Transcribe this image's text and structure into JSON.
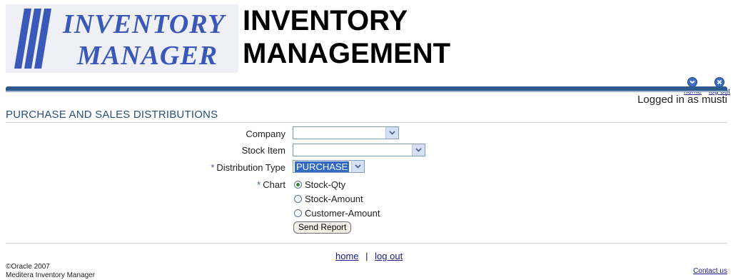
{
  "branding": {
    "logo_line1": "INVENTORY",
    "logo_line2": "MANAGER",
    "heading_line1": "INVENTORY",
    "heading_line2": "MANAGEMENT"
  },
  "global_nav": {
    "home_label": "home",
    "logout_label": "log out"
  },
  "session": {
    "logged_in_text": "Logged in as musti"
  },
  "page": {
    "title": "PURCHASE AND SALES DISTRIBUTIONS"
  },
  "form": {
    "company_label": "Company",
    "company_value": "",
    "stock_item_label": "Stock Item",
    "stock_item_value": "",
    "distribution_type_label": "Distribution Type",
    "distribution_type_value": "PURCHASE",
    "chart_label": "Chart",
    "required_marker": "*",
    "chart_options": [
      "Stock-Qty",
      "Stock-Amount",
      "Customer-Amount"
    ],
    "chart_selected": "Stock-Qty",
    "send_label": "Send Report"
  },
  "footer": {
    "home_label": "home",
    "separator": "|",
    "logout_label": "log out",
    "copyright": "©Oracle 2007",
    "app_name": "Meditera Inventory Manager",
    "contact_label": "Contact us"
  },
  "colors": {
    "accent": "#2c5a8c",
    "section_title": "#2a4f7c",
    "logo_blue": "#3a58b8",
    "selection": "#316ac5"
  }
}
